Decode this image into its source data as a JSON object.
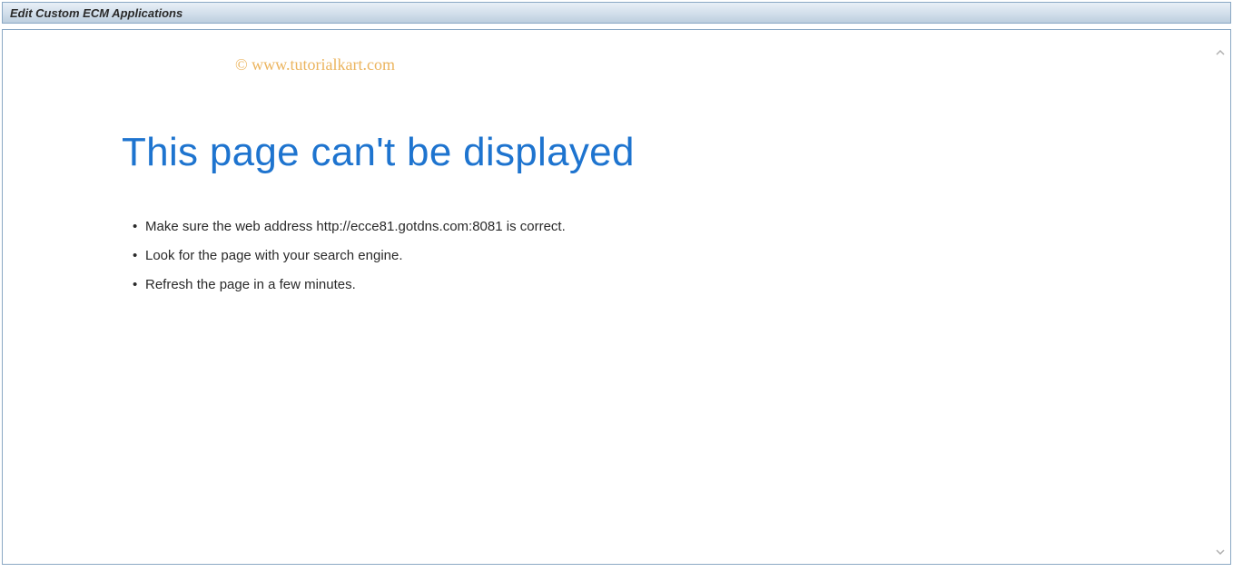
{
  "titlebar": {
    "title": "Edit Custom ECM Applications"
  },
  "watermark": {
    "text": "© www.tutorialkart.com"
  },
  "error": {
    "heading": "This page can't be displayed",
    "bullets": [
      "Make sure the web address http://ecce81.gotdns.com:8081 is correct.",
      "Look for the page with your search engine.",
      "Refresh the page in a few minutes."
    ]
  }
}
